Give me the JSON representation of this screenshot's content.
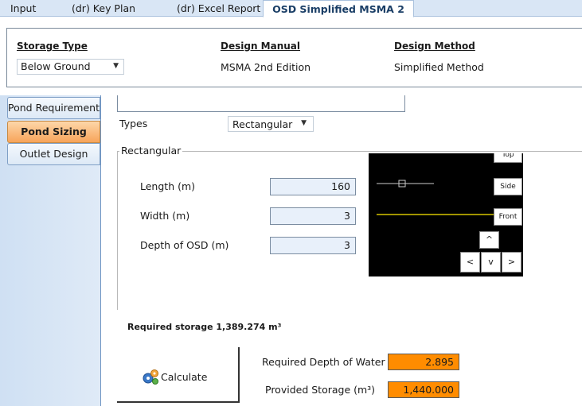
{
  "tabs": [
    "Input",
    "(dr) Key Plan",
    "(dr) Excel Report",
    "OSD Simplified MSMA 2"
  ],
  "header": {
    "storage_type_label": "Storage Type",
    "storage_type_value": "Below Ground",
    "design_manual_label": "Design Manual",
    "design_manual_value": "MSMA 2nd Edition",
    "design_method_label": "Design Method",
    "design_method_value": "Simplified Method"
  },
  "nav": [
    "Pond Requirement",
    "Pond Sizing",
    "Outlet Design"
  ],
  "sizing": {
    "types_label": "Types",
    "types_value": "Rectangular",
    "group_title": "Rectangular",
    "length_label": "Length (m)",
    "length_value": "160",
    "width_label": "Width (m)",
    "width_value": "3",
    "depth_label": "Depth of OSD (m)",
    "depth_value": "3",
    "required_storage": "Required storage 1,389.274 m³",
    "calculate_label": "Calculate",
    "req_depth_label": "Required Depth of Water (m)",
    "req_depth_value": "2.895",
    "provided_storage_label": "Provided Storage (m³)",
    "provided_storage_value": "1,440.000"
  },
  "view": {
    "top": "Top",
    "side": "Side",
    "front": "Front",
    "up": "^",
    "left": "<",
    "down": "v",
    "right": ">"
  },
  "colors": {
    "tabbar": "#d9e6f5",
    "nav_active": "#f7a45a",
    "output_fill": "#ff8c00",
    "preview_bg": "#000000",
    "front_line": "#d6c400"
  },
  "icons": {
    "calculate": "gears-icon",
    "dropdown": "chevron-down-icon"
  }
}
